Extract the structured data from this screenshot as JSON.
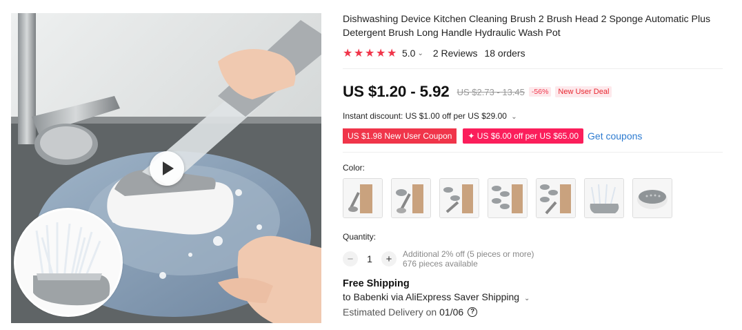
{
  "product": {
    "title": "Dishwashing Device Kitchen Cleaning Brush 2 Brush Head 2 Sponge Automatic Plus Detergent Brush Long Handle Hydraulic Wash Pot",
    "media": {
      "play_icon": "play-icon",
      "inset_icon": "brush-head-image"
    }
  },
  "rating": {
    "stars": 5,
    "value": "5.0",
    "chevron": "⌄",
    "reviews": "2 Reviews",
    "orders": "18 orders"
  },
  "price": {
    "current": "US $1.20 - 5.92",
    "original": "US $2.73 - 13.45",
    "discount": "-56%",
    "deal": "New User Deal"
  },
  "promo": {
    "instant_discount": "Instant discount: US $1.00 off per US $29.00",
    "instant_chevron": "⌄",
    "coupon_new_user": "US $1.98 New User Coupon",
    "coupon_store": "✦ US $6.00 off per US $65.00",
    "get_coupons": "Get coupons"
  },
  "variants": {
    "label": "Color:",
    "options": [
      {
        "icon": "brush-box-variant-1"
      },
      {
        "icon": "brush-box-variant-2"
      },
      {
        "icon": "brush-box-variant-3"
      },
      {
        "icon": "brush-box-variant-4"
      },
      {
        "icon": "brush-box-variant-5"
      },
      {
        "icon": "brush-head-variant"
      },
      {
        "icon": "sponge-head-variant"
      }
    ]
  },
  "quantity": {
    "label": "Quantity:",
    "minus": "−",
    "value": "1",
    "plus": "+",
    "note_line1": "Additional 2% off (5 pieces or more)",
    "note_line2": "676 pieces available"
  },
  "shipping": {
    "title": "Free Shipping",
    "via": "to Babenki via AliExpress Saver Shipping",
    "via_chevron": "⌄",
    "delivery_label": "Estimated Delivery on",
    "delivery_date": "01/06",
    "help_icon": "?"
  },
  "colors": {
    "accent": "#f0354a",
    "link": "#2d7bd0",
    "coupon_pink": "#fb1e5b"
  }
}
